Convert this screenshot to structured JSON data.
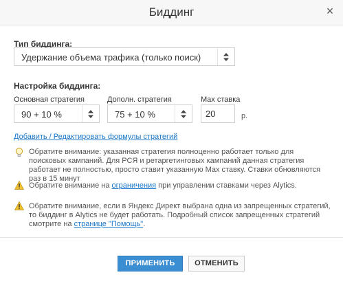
{
  "dialog": {
    "title": "Биддинг",
    "close_glyph": "×"
  },
  "bidding_type": {
    "label": "Тип биддинга:",
    "selected": "Удержание объема трафика (только поиск)"
  },
  "bidding_settings": {
    "label": "Настройка биддинга:",
    "main_strategy": {
      "label": "Основная стратегия",
      "selected": "90 + 10 %"
    },
    "extra_strategy": {
      "label": "Дополн. стратегия",
      "selected": "75 + 10 %"
    },
    "max_bid": {
      "label": "Max ставка",
      "value": "20",
      "unit": "р."
    }
  },
  "edit_link": "Добавить / Редактировать формулы стратегий",
  "notes": {
    "note1": "Обратите внимание: указанная стратегия полноценно работает только для поисковых кампаний. Для РСЯ и ретаргетинговых кампаний данная стратегия работает не полностью, просто ставит указанную Max ставку. Ставки обновляются раз в 15 минут",
    "note2_before": "Обратите внимание на ",
    "note2_link": "ограничения",
    "note2_after": " при управлении ставками через Alytics.",
    "note3_text": "Обратите внимание, если в Яндекс Директ выбрана одна из запрещенных стратегий, то биддинг в Alytics не будет работать. Подробный список запрещенных стратегий смотрите на ",
    "note3_link": "странице \"Помощь\"",
    "note3_after": "."
  },
  "icons": {
    "close": "close-icon",
    "select_arrows": "chevron-updown-icon",
    "tip": "lightbulb-icon",
    "warning": "warning-icon"
  },
  "colors": {
    "primary_button": "#3c8ed3",
    "link": "#1a77c9",
    "warning": "#f2c12e"
  },
  "buttons": {
    "apply": "ПРИМЕНИТЬ",
    "cancel": "ОТМЕНИТЬ"
  }
}
